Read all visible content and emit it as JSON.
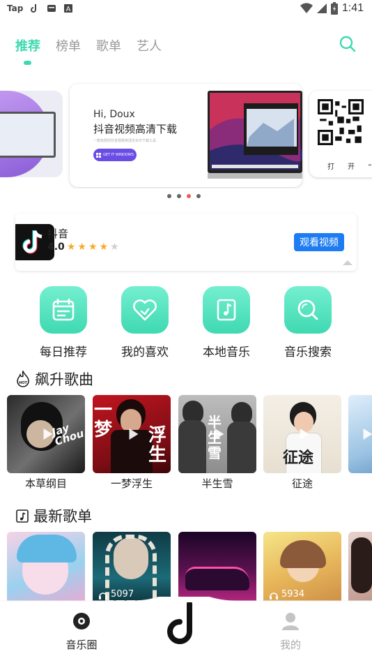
{
  "status_bar": {
    "app_label": "Tap",
    "time": "1:41"
  },
  "tabs": [
    {
      "label": "推荐",
      "active": true
    },
    {
      "label": "榜单",
      "active": false
    },
    {
      "label": "歌单",
      "active": false
    },
    {
      "label": "艺人",
      "active": false
    }
  ],
  "banner": {
    "greeting": "Hi, Doux",
    "title": "抖音视频高清下载",
    "subtitle": "一款免费的抖音视频高清无水印下载工具",
    "cta_label": "GET IT WINDOWS",
    "right_caption": "打 开 “ 微",
    "dots": [
      false,
      false,
      true,
      false
    ]
  },
  "app_card": {
    "name": "抖音",
    "rating": "4.0",
    "stars_filled": 4,
    "stars_total": 5,
    "action_label": "观看视频"
  },
  "quick_actions": [
    {
      "label": "每日推荐",
      "icon": "calendar-icon"
    },
    {
      "label": "我的喜欢",
      "icon": "heart-icon"
    },
    {
      "label": "本地音乐",
      "icon": "music-file-icon"
    },
    {
      "label": "音乐搜索",
      "icon": "search-icon"
    }
  ],
  "trending": {
    "title": "飙升歌曲",
    "badge": "HOT",
    "songs": [
      {
        "label": "本草纲目",
        "cover_text": "Jay Chou"
      },
      {
        "label": "一梦浮生",
        "cover_text": "一梦浮生"
      },
      {
        "label": "半生雪",
        "cover_text": "半生雪"
      },
      {
        "label": "征途",
        "cover_text": "征途"
      },
      {
        "label": "",
        "cover_text": ""
      }
    ]
  },
  "playlists": {
    "title": "最新歌单",
    "items": [
      {
        "count": ""
      },
      {
        "count": "5097"
      },
      {
        "count": ""
      },
      {
        "count": "5934"
      },
      {
        "count": ""
      }
    ]
  },
  "bottom_nav": {
    "left_label": "音乐圈",
    "right_label": "我的"
  },
  "colors": {
    "accent": "#3dd9b0",
    "dot_active": "#ef5a5a",
    "button_blue": "#1d7cf2",
    "star": "#f7a92a"
  }
}
